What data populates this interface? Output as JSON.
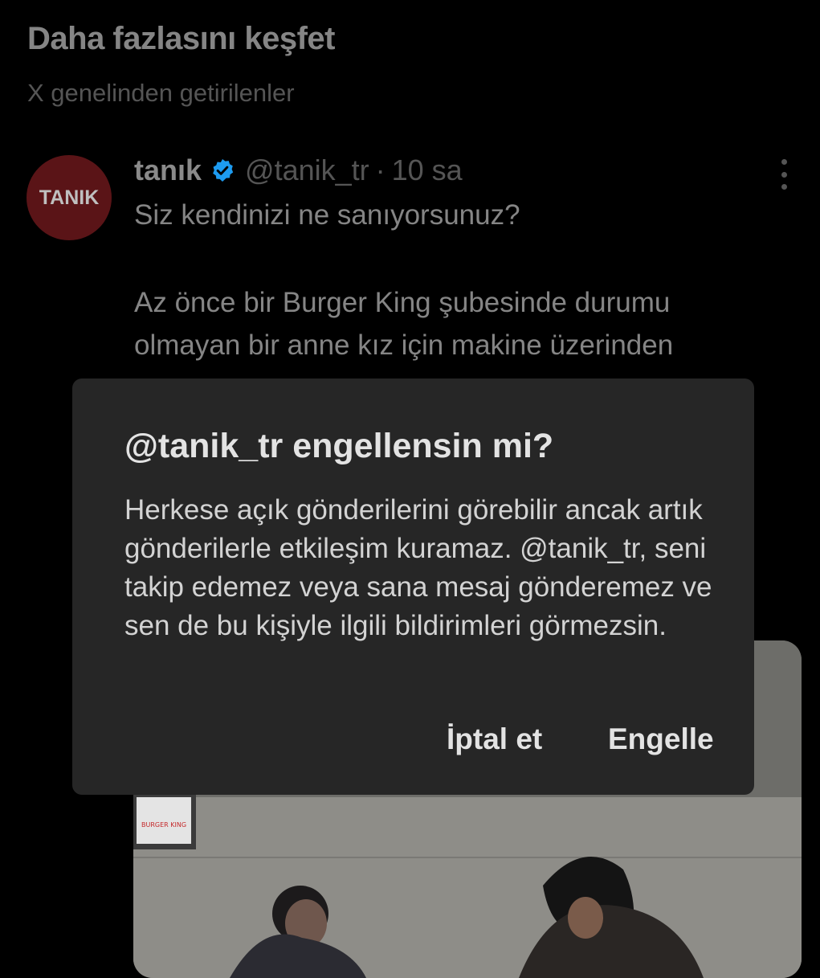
{
  "section": {
    "title": "Daha fazlasını keşfet",
    "subtitle": "X genelinden getirilenler"
  },
  "tweet": {
    "avatar_text": "TANIK",
    "author_name": "tanık",
    "verified_icon": "verified-badge-icon",
    "handle": "@tanik_tr",
    "separator": "·",
    "time": "10 sa",
    "lines": [
      "Siz kendinizi ne sanıyorsunuz?",
      "Az önce bir Burger King şubesinde durumu",
      "olmayan bir anne kız için makine üzerinden"
    ],
    "media_sign": "BURGER KING"
  },
  "dialog": {
    "title": "@tanik_tr engellensin mi?",
    "body": "Herkese açık gönderilerini görebilir ancak artık gönderilerle etkileşim kuramaz. @tanik_tr, seni takip edemez veya sana mesaj gönderemez ve sen de bu kişiyle ilgili bildirimleri görmezsin.",
    "cancel_label": "İptal et",
    "block_label": "Engelle"
  },
  "colors": {
    "background": "#000000",
    "dialog_bg": "#262626",
    "avatar_bg": "#5a1417",
    "verified_blue": "#1d9bf0"
  }
}
